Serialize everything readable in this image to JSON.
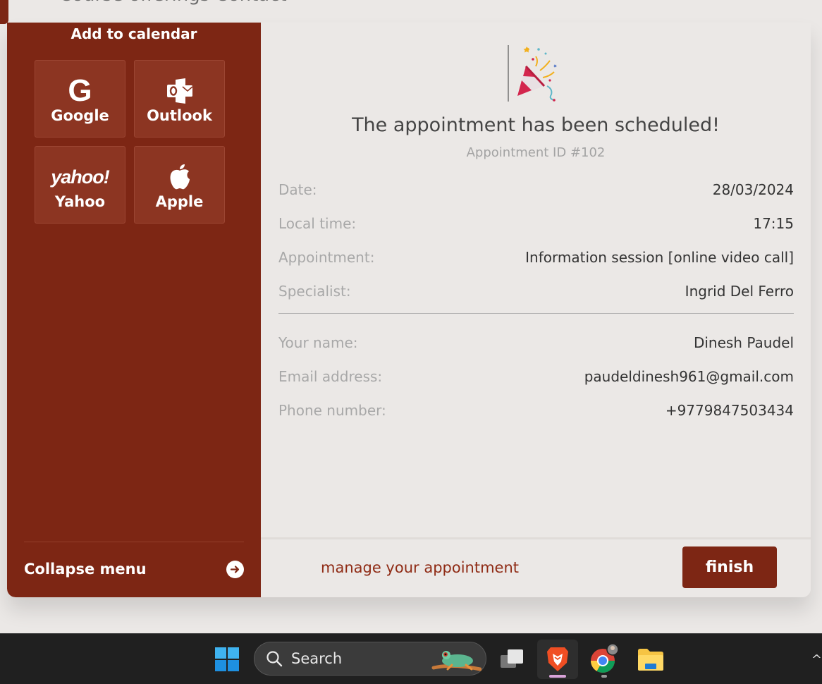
{
  "background_page": {
    "top_nav_text": "Course offerings    Contact"
  },
  "sidebar": {
    "calendar_title": "Add to calendar",
    "calendar_options": [
      {
        "label": "Google",
        "icon": "google-icon"
      },
      {
        "label": "Outlook",
        "icon": "outlook-icon"
      },
      {
        "label": "Yahoo",
        "icon": "yahoo-icon"
      },
      {
        "label": "Apple",
        "icon": "apple-icon"
      }
    ],
    "collapse_label": "Collapse menu"
  },
  "main": {
    "headline": "The appointment has been scheduled!",
    "appointment_id": "Appointment ID #102",
    "details": [
      {
        "key": "Date:",
        "value": "28/03/2024"
      },
      {
        "key": "Local time:",
        "value": "17:15"
      },
      {
        "key": "Appointment:",
        "value": "Information session [online video call]"
      },
      {
        "key": "Specialist:",
        "value": "Ingrid Del Ferro"
      }
    ],
    "contact": [
      {
        "key": "Your name:",
        "value": "Dinesh Paudel"
      },
      {
        "key": "Email address:",
        "value": "paudeldinesh961@gmail.com"
      },
      {
        "key": "Phone number:",
        "value": "+9779847503434"
      }
    ]
  },
  "footer": {
    "manage_link": "manage your appointment",
    "finish_label": "finish"
  },
  "taskbar": {
    "search_placeholder": "Search",
    "apps": [
      "task-view",
      "brave",
      "chrome",
      "file-explorer"
    ]
  },
  "colors": {
    "brand": "#7d2614",
    "background": "#ebe8e6",
    "link": "#8f2b15"
  }
}
